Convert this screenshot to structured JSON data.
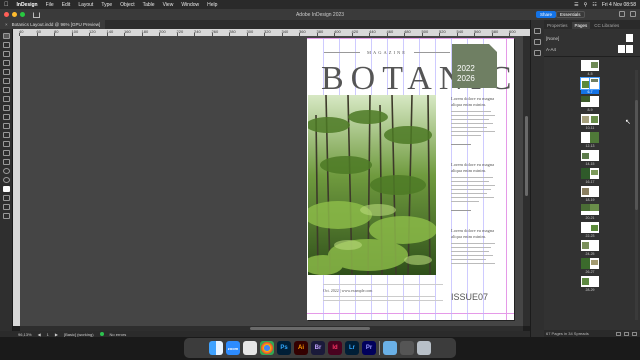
{
  "menubar": {
    "app_name": "InDesign",
    "items": [
      "File",
      "Edit",
      "Layout",
      "Type",
      "Object",
      "Table",
      "View",
      "Window",
      "Help"
    ],
    "clock": "Fri 4 Nov 08:58"
  },
  "appbar": {
    "title": "Adobe InDesign 2023",
    "share_label": "Share",
    "workspace_label": "Essentials"
  },
  "document_tab": {
    "label": "Botanics Layout.indd @ 96% [GPU Preview]",
    "close": "×"
  },
  "ruler": {
    "h_labels": [
      "40",
      "60",
      "80",
      "100",
      "120",
      "140",
      "160",
      "180",
      "200",
      "220",
      "240",
      "260",
      "280",
      "300",
      "320",
      "340",
      "360",
      "380",
      "400",
      "420",
      "440",
      "460",
      "480",
      "500",
      "520",
      "540",
      "560",
      "580",
      "600"
    ]
  },
  "page": {
    "magazine_label": "MAGAZINE",
    "title": "BOTANIC",
    "year_start": "2022",
    "year_end": "2026",
    "heading_1": "Lorem dolore eu magna aliqua enim minim.",
    "heading_2": "Lorem dolore eu magna aliqua enim minim.",
    "heading_3": "Lorem dolore eu magna aliqua enim minim.",
    "footer": "Oct. 2022   |   www.example.com",
    "issue": "ISSUE07"
  },
  "statusbar": {
    "zoom": "96,13%",
    "page": "1",
    "style": "[Basic] (working)",
    "errors": "No errors"
  },
  "pages_panel": {
    "tabs": [
      "Properties",
      "Pages",
      "CC Libraries"
    ],
    "active_tab": "Pages",
    "none_label": "[None]",
    "master_label": "A-A4",
    "spreads": [
      "4-5",
      "6-7",
      "8-9",
      "10-11",
      "12-13",
      "14-15",
      "16-17",
      "18-19",
      "20-21",
      "22-23",
      "24-25",
      "26-27",
      "28-29"
    ],
    "selected_spread": "6-7",
    "footer": "67 Pages in 34 Spreads"
  },
  "dock": {
    "icons": [
      "finder-icon",
      "zoom-icon",
      "launchpad-icon",
      "chrome-icon",
      "photoshop-icon",
      "illustrator-icon",
      "bridge-icon",
      "indesign-icon",
      "lightroom-icon",
      "premiere-icon",
      "preview-icon",
      "calculator-icon",
      "trash-icon"
    ],
    "zoom_label": "zoom"
  },
  "colors": {
    "accent": "#1473e6",
    "green_box": "#6f7f63",
    "margin_guide": "#e59ae8",
    "column_guide": "#b9b5ff"
  }
}
